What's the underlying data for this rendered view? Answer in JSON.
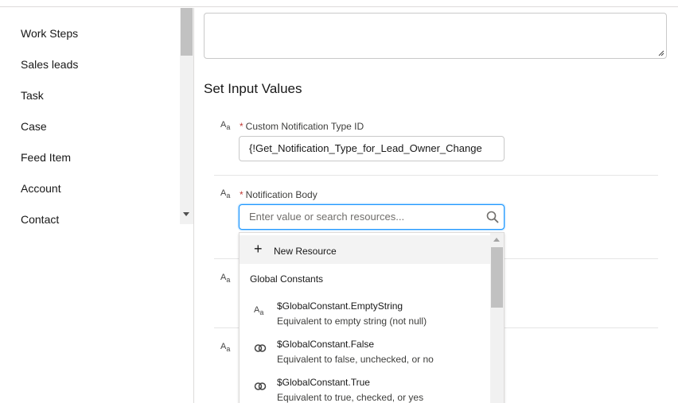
{
  "sidebar": {
    "items": [
      {
        "label": "Work Steps"
      },
      {
        "label": "Sales leads"
      },
      {
        "label": "Task"
      },
      {
        "label": "Case"
      },
      {
        "label": "Feed Item"
      },
      {
        "label": "Account"
      },
      {
        "label": "Contact"
      }
    ]
  },
  "main": {
    "section_title": "Set Input Values",
    "type_icon_text": "A",
    "type_icon_sub": "a",
    "fields": [
      {
        "label": "Custom Notification Type ID",
        "required_mark": "*",
        "value": "{!Get_Notification_Type_for_Lead_Owner_Change"
      },
      {
        "label": "Notification Body",
        "required_mark": "*",
        "placeholder": "Enter value or search resources..."
      }
    ]
  },
  "dropdown": {
    "new_resource_icon": "+",
    "new_resource_label": "New Resource",
    "group_label": "Global Constants",
    "options": [
      {
        "icon": "text-type-icon",
        "title": "$GlobalConstant.EmptyString",
        "description": "Equivalent to empty string (not null)"
      },
      {
        "icon": "boolean-toggle-icon",
        "title": "$GlobalConstant.False",
        "description": "Equivalent to false, unchecked, or no"
      },
      {
        "icon": "boolean-toggle-icon",
        "title": "$GlobalConstant.True",
        "description": "Equivalent to true, checked, or yes"
      }
    ]
  },
  "colors": {
    "focus_border": "#1b96ff",
    "required": "#c23934",
    "hover_bg": "#f3f3f3"
  }
}
